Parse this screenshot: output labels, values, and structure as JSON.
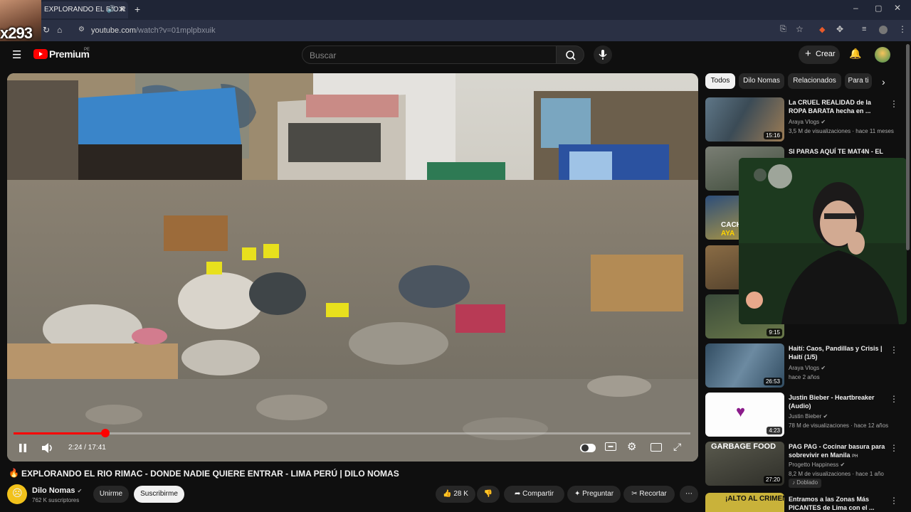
{
  "browser": {
    "tab_title": "EXPLORANDO EL RIO R",
    "url_host": "youtube.com",
    "url_path": "/watch?v=01mplpbxuik",
    "overlay_text": "x293"
  },
  "header": {
    "logo": "Premium",
    "logo_region": "PE",
    "search_placeholder": "Buscar",
    "create_label": "Crear"
  },
  "player": {
    "current_time": "2:24",
    "duration": "17:41",
    "time_display": "2:24 / 17:41",
    "progress": 0.136
  },
  "video": {
    "title": "EXPLORANDO EL RIO RIMAC - DONDE NADIE QUIERE ENTRAR - LIMA PERÚ | DILO NOMAS",
    "channel": "Dilo Nomas",
    "subscribers": "762 K suscriptores",
    "join_label": "Unirme",
    "subscribe_label": "Suscribirme",
    "likes": "28 K",
    "share_label": "Compartir",
    "ask_label": "Preguntar",
    "clip_label": "Recortar"
  },
  "sidebar": {
    "chips": [
      "Todos",
      "Dilo Nomas",
      "Relacionados",
      "Para ti"
    ],
    "items": [
      {
        "title": "La CRUEL REALIDAD de la ROPA BARATA hecha en ...",
        "channel": "Araya Vlogs",
        "meta": "3,5 M de visualizaciones · hace 11 meses",
        "duration": "15:16"
      },
      {
        "title": "SI PARAS AQUÍ TE MAT4N - EL",
        "channel": "",
        "meta": "",
        "duration": ""
      },
      {
        "title": "Haití: Caos, Pandillas y Crisis | Haití (1/5)",
        "channel": "Araya Vlogs",
        "meta": "hace 2 años",
        "duration": "26:53"
      },
      {
        "title": "Justin Bieber - Heartbreaker (Audio)",
        "channel": "Justin Bieber",
        "meta": "78 M de visualizaciones · hace 12 años",
        "duration": "4:23"
      },
      {
        "title": "PAG PAG - Cocinar basura para sobrevivir en Manila",
        "channel": "Progetto Happiness",
        "meta": "8,2 M de visualizaciones · hace 1 año",
        "badge": "Doblado",
        "duration": "27:20",
        "thumb_text": "GARBAGE FOOD"
      },
      {
        "title": "Entramos a las Zonas Más PICANTES de Lima con el ...",
        "channel": "",
        "meta": "",
        "duration": "",
        "thumb_text": "¡ALTO AL CRIMEN!"
      }
    ],
    "thumb_labels": [
      "CACH",
      "AYA"
    ],
    "extra_duration": "9:15",
    "ph_mark": "PH"
  },
  "colors": {
    "accent": "#ff0000",
    "background": "#0f0f0f",
    "chrome": "#2a3044"
  }
}
